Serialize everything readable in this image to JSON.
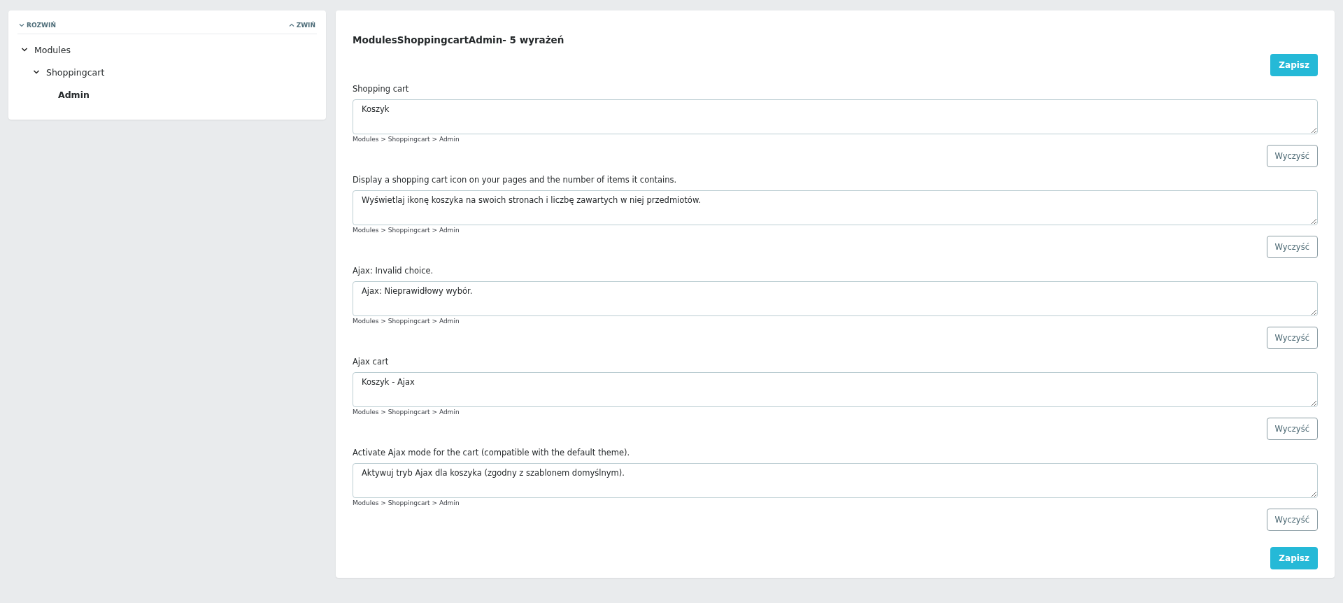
{
  "tree_toolbar": {
    "expand": "ROZWIŃ",
    "collapse": "ZWIŃ"
  },
  "tree": [
    {
      "label": "Modules",
      "expanded": true,
      "selected": false,
      "children": [
        {
          "label": "Shoppingcart",
          "expanded": true,
          "selected": false,
          "children": [
            {
              "label": "Admin",
              "selected": true
            }
          ]
        }
      ]
    }
  ],
  "title": "ModulesShoppingcartAdmin- 5 wyrażeń",
  "save_label": "Zapisz",
  "entries": [
    {
      "label": "Shopping cart",
      "value": "Koszyk",
      "path": "Modules > Shoppingcart > Admin",
      "clear": "Wyczyść"
    },
    {
      "label": "Display a shopping cart icon on your pages and the number of items it contains.",
      "value": "Wyświetlaj ikonę koszyka na swoich stronach i liczbę zawartych w niej przedmiotów.",
      "path": "Modules > Shoppingcart > Admin",
      "clear": "Wyczyść"
    },
    {
      "label": "Ajax: Invalid choice.",
      "value": "Ajax: Nieprawidłowy wybór.",
      "path": "Modules > Shoppingcart > Admin",
      "clear": "Wyczyść"
    },
    {
      "label": "Ajax cart",
      "value": "Koszyk - Ajax",
      "path": "Modules > Shoppingcart > Admin",
      "clear": "Wyczyść"
    },
    {
      "label": "Activate Ajax mode for the cart (compatible with the default theme).",
      "value": "Aktywuj tryb Ajax dla koszyka (zgodny z szablonem domyślnym).",
      "path": "Modules > Shoppingcart > Admin",
      "clear": "Wyczyść"
    }
  ],
  "save_label_bottom": "Zapisz"
}
